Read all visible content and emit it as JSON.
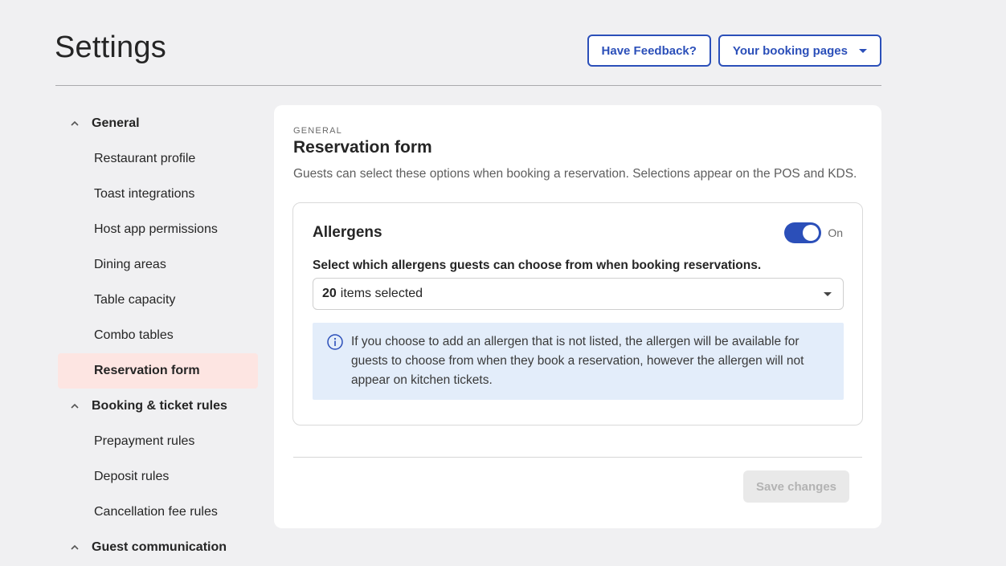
{
  "header": {
    "title": "Settings",
    "feedback_label": "Have Feedback?",
    "booking_pages_label": "Your booking pages"
  },
  "sidebar": {
    "groups": [
      {
        "label": "General",
        "items": [
          {
            "label": "Restaurant profile"
          },
          {
            "label": "Toast integrations"
          },
          {
            "label": "Host app permissions"
          },
          {
            "label": "Dining areas"
          },
          {
            "label": "Table capacity"
          },
          {
            "label": "Combo tables"
          },
          {
            "label": "Reservation form"
          }
        ]
      },
      {
        "label": "Booking & ticket rules",
        "items": [
          {
            "label": "Prepayment rules"
          },
          {
            "label": "Deposit rules"
          },
          {
            "label": "Cancellation fee rules"
          }
        ]
      },
      {
        "label": "Guest communication",
        "items": []
      }
    ],
    "active_item": "Reservation form"
  },
  "main": {
    "eyebrow": "GENERAL",
    "title": "Reservation form",
    "description": "Guests can select these options when booking a reservation. Selections appear on the POS and KDS.",
    "allergens": {
      "title": "Allergens",
      "toggle_state": "On",
      "select_label": "Select which allergens guests can choose from when booking reservations.",
      "selected_count": "20",
      "selected_suffix": "items selected",
      "info_text": "If you choose to add an allergen that is not listed, the allergen will be available for guests to choose from when they book a reservation, however the allergen will not appear on kitchen tickets."
    },
    "save_label": "Save changes"
  },
  "colors": {
    "accent": "#2b4fb9",
    "active_nav_bg": "#fde5e2",
    "info_bg": "#e3edfa",
    "page_bg": "#f0f0f2"
  }
}
